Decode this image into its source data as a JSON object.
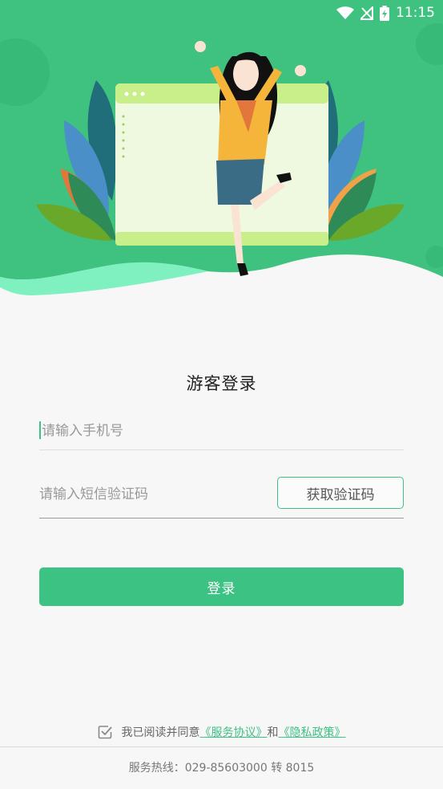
{
  "status_bar": {
    "time": "11:15",
    "icons": [
      "wifi-icon",
      "no-signal-icon",
      "battery-charging-icon"
    ]
  },
  "hero": {
    "illustration": "woman-cheering-illustration"
  },
  "login": {
    "title": "游客登录",
    "phone_placeholder": "请输入手机号",
    "code_placeholder": "请输入短信验证码",
    "get_code_label": "获取验证码",
    "submit_label": "登录"
  },
  "agreement": {
    "checked": true,
    "prefix": "我已阅读并同意",
    "service_link": "《服务协议》",
    "and": "和",
    "privacy_link": "《隐私政策》"
  },
  "footer": {
    "hotline": "服务热线：029-85603000 转 8015"
  },
  "colors": {
    "brand": "#3cc282",
    "hero_bg": "#3fc27f"
  }
}
